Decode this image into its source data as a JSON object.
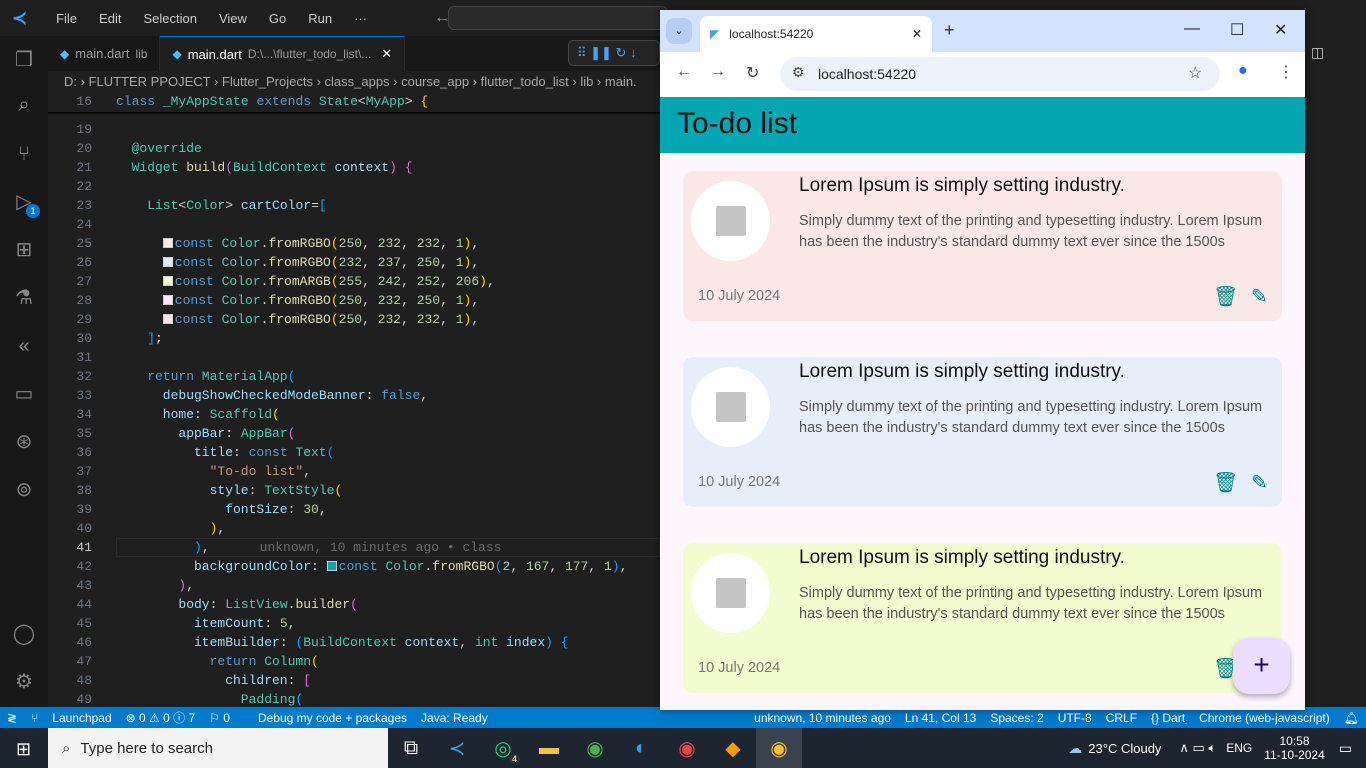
{
  "vscode": {
    "menu": [
      "File",
      "Edit",
      "Selection",
      "View",
      "Go",
      "Run",
      "···"
    ],
    "tabs": [
      {
        "name": "main.dart",
        "sub": "lib"
      },
      {
        "name": "main.dart",
        "sub": "D:\\...\\flutter_todo_list\\...",
        "close": "✕"
      }
    ],
    "breadcrumb": "D: › FLUTTER PPOJECT › Flutter_Projects › class_apps › course_app › flutter_todo_list › lib › main.",
    "debug_badge": "1",
    "current_line": 41,
    "blame": "unknown, 10 minutes ago • class",
    "swatch_colors": [
      "#fae8e8",
      "#e8edfa",
      "#f2fcce",
      "#fae8fa",
      "#fae8e8",
      "#02a7b1"
    ],
    "code": [
      {
        "n": 16,
        "i": 0,
        "t": [
          [
            "k",
            "class "
          ],
          [
            "t",
            "_MyAppState "
          ],
          [
            "k",
            "extends "
          ],
          [
            "t",
            "State"
          ],
          [
            "p",
            "<"
          ],
          [
            "t",
            "MyApp"
          ],
          [
            "p",
            "> "
          ],
          [
            "b1",
            "{"
          ]
        ]
      },
      {
        "n": 19,
        "i": 0,
        "t": []
      },
      {
        "n": 20,
        "i": 2,
        "t": [
          [
            "a",
            "@override"
          ]
        ]
      },
      {
        "n": 21,
        "i": 2,
        "t": [
          [
            "t",
            "Widget "
          ],
          [
            "f",
            "build"
          ],
          [
            "b2",
            "("
          ],
          [
            "t",
            "BuildContext "
          ],
          [
            "v",
            "context"
          ],
          [
            "b2",
            ")"
          ],
          [
            "p",
            " "
          ],
          [
            "b2",
            "{"
          ]
        ]
      },
      {
        "n": 22,
        "i": 0,
        "t": []
      },
      {
        "n": 23,
        "i": 4,
        "t": [
          [
            "t",
            "List"
          ],
          [
            "p",
            "<"
          ],
          [
            "t",
            "Color"
          ],
          [
            "p",
            "> "
          ],
          [
            "v",
            "cartColor"
          ],
          [
            "p",
            "="
          ],
          [
            "b3",
            "["
          ]
        ]
      },
      {
        "n": 24,
        "i": 0,
        "t": []
      },
      {
        "n": 25,
        "i": 6,
        "sw": 0,
        "t": [
          [
            "k",
            "const "
          ],
          [
            "t",
            "Color"
          ],
          [
            "p",
            "."
          ],
          [
            "f",
            "fromRGBO"
          ],
          [
            "b1",
            "("
          ],
          [
            "n",
            "250"
          ],
          [
            "p",
            ", "
          ],
          [
            "n",
            "232"
          ],
          [
            "p",
            ", "
          ],
          [
            "n",
            "232"
          ],
          [
            "p",
            ", "
          ],
          [
            "n",
            "1"
          ],
          [
            "b1",
            ")"
          ],
          [
            "p",
            ","
          ]
        ]
      },
      {
        "n": 26,
        "i": 6,
        "sw": 1,
        "t": [
          [
            "k",
            "const "
          ],
          [
            "t",
            "Color"
          ],
          [
            "p",
            "."
          ],
          [
            "f",
            "fromRGBO"
          ],
          [
            "b1",
            "("
          ],
          [
            "n",
            "232"
          ],
          [
            "p",
            ", "
          ],
          [
            "n",
            "237"
          ],
          [
            "p",
            ", "
          ],
          [
            "n",
            "250"
          ],
          [
            "p",
            ", "
          ],
          [
            "n",
            "1"
          ],
          [
            "b1",
            ")"
          ],
          [
            "p",
            ","
          ]
        ]
      },
      {
        "n": 27,
        "i": 6,
        "sw": 2,
        "t": [
          [
            "k",
            "const "
          ],
          [
            "t",
            "Color"
          ],
          [
            "p",
            "."
          ],
          [
            "f",
            "fromARGB"
          ],
          [
            "b1",
            "("
          ],
          [
            "n",
            "255"
          ],
          [
            "p",
            ", "
          ],
          [
            "n",
            "242"
          ],
          [
            "p",
            ", "
          ],
          [
            "n",
            "252"
          ],
          [
            "p",
            ", "
          ],
          [
            "n",
            "206"
          ],
          [
            "b1",
            ")"
          ],
          [
            "p",
            ","
          ]
        ]
      },
      {
        "n": 28,
        "i": 6,
        "sw": 3,
        "t": [
          [
            "k",
            "const "
          ],
          [
            "t",
            "Color"
          ],
          [
            "p",
            "."
          ],
          [
            "f",
            "fromRGBO"
          ],
          [
            "b1",
            "("
          ],
          [
            "n",
            "250"
          ],
          [
            "p",
            ", "
          ],
          [
            "n",
            "232"
          ],
          [
            "p",
            ", "
          ],
          [
            "n",
            "250"
          ],
          [
            "p",
            ", "
          ],
          [
            "n",
            "1"
          ],
          [
            "b1",
            ")"
          ],
          [
            "p",
            ","
          ]
        ]
      },
      {
        "n": 29,
        "i": 6,
        "sw": 4,
        "t": [
          [
            "k",
            "const "
          ],
          [
            "t",
            "Color"
          ],
          [
            "p",
            "."
          ],
          [
            "f",
            "fromRGBO"
          ],
          [
            "b1",
            "("
          ],
          [
            "n",
            "250"
          ],
          [
            "p",
            ", "
          ],
          [
            "n",
            "232"
          ],
          [
            "p",
            ", "
          ],
          [
            "n",
            "232"
          ],
          [
            "p",
            ", "
          ],
          [
            "n",
            "1"
          ],
          [
            "b1",
            ")"
          ],
          [
            "p",
            ","
          ]
        ]
      },
      {
        "n": 30,
        "i": 4,
        "t": [
          [
            "b3",
            "]"
          ],
          [
            "p",
            ";"
          ]
        ]
      },
      {
        "n": 31,
        "i": 0,
        "t": []
      },
      {
        "n": 32,
        "i": 4,
        "t": [
          [
            "k",
            "return "
          ],
          [
            "t",
            "MaterialApp"
          ],
          [
            "b3",
            "("
          ]
        ]
      },
      {
        "n": 33,
        "i": 6,
        "t": [
          [
            "v",
            "debugShowCheckedModeBanner"
          ],
          [
            "p",
            ": "
          ],
          [
            "k",
            "false"
          ],
          [
            "p",
            ","
          ]
        ]
      },
      {
        "n": 34,
        "i": 6,
        "t": [
          [
            "v",
            "home"
          ],
          [
            "p",
            ": "
          ],
          [
            "t",
            "Scaffold"
          ],
          [
            "b1",
            "("
          ]
        ]
      },
      {
        "n": 35,
        "i": 8,
        "t": [
          [
            "v",
            "appBar"
          ],
          [
            "p",
            ": "
          ],
          [
            "t",
            "AppBar"
          ],
          [
            "b2",
            "("
          ]
        ]
      },
      {
        "n": 36,
        "i": 10,
        "t": [
          [
            "v",
            "title"
          ],
          [
            "p",
            ": "
          ],
          [
            "k",
            "const "
          ],
          [
            "t",
            "Text"
          ],
          [
            "b3",
            "("
          ]
        ]
      },
      {
        "n": 37,
        "i": 12,
        "t": [
          [
            "s",
            "\"To-do list\""
          ],
          [
            "p",
            ","
          ]
        ]
      },
      {
        "n": 38,
        "i": 12,
        "t": [
          [
            "v",
            "style"
          ],
          [
            "p",
            ": "
          ],
          [
            "t",
            "TextStyle"
          ],
          [
            "b1",
            "("
          ]
        ]
      },
      {
        "n": 39,
        "i": 14,
        "t": [
          [
            "v",
            "fontSize"
          ],
          [
            "p",
            ": "
          ],
          [
            "n",
            "30"
          ],
          [
            "p",
            ","
          ]
        ]
      },
      {
        "n": 40,
        "i": 12,
        "t": [
          [
            "b1",
            ")"
          ],
          [
            "p",
            ","
          ]
        ]
      },
      {
        "n": 41,
        "i": 10,
        "blame": true,
        "t": [
          [
            "b3",
            ")"
          ],
          [
            "p",
            ","
          ]
        ]
      },
      {
        "n": 42,
        "i": 10,
        "t": [
          [
            "v",
            "backgroundColor"
          ],
          [
            "p",
            ": "
          ],
          [
            "sw5",
            ""
          ],
          [
            "k",
            "const "
          ],
          [
            "t",
            "Color"
          ],
          [
            "p",
            "."
          ],
          [
            "f",
            "fromRGBO"
          ],
          [
            "b3",
            "("
          ],
          [
            "n",
            "2"
          ],
          [
            "p",
            ", "
          ],
          [
            "n",
            "167"
          ],
          [
            "p",
            ", "
          ],
          [
            "n",
            "177"
          ],
          [
            "p",
            ", "
          ],
          [
            "n",
            "1"
          ],
          [
            "b3",
            ")"
          ],
          [
            "p",
            ","
          ]
        ]
      },
      {
        "n": 43,
        "i": 8,
        "t": [
          [
            "b2",
            ")"
          ],
          [
            "p",
            ","
          ]
        ]
      },
      {
        "n": 44,
        "i": 8,
        "t": [
          [
            "v",
            "body"
          ],
          [
            "p",
            ": "
          ],
          [
            "t",
            "ListView"
          ],
          [
            "p",
            "."
          ],
          [
            "f",
            "builder"
          ],
          [
            "b2",
            "("
          ]
        ]
      },
      {
        "n": 45,
        "i": 10,
        "t": [
          [
            "v",
            "itemCount"
          ],
          [
            "p",
            ": "
          ],
          [
            "n",
            "5"
          ],
          [
            "p",
            ","
          ]
        ]
      },
      {
        "n": 46,
        "i": 10,
        "t": [
          [
            "v",
            "itemBuilder"
          ],
          [
            "p",
            ": "
          ],
          [
            "b3",
            "("
          ],
          [
            "t",
            "BuildContext "
          ],
          [
            "v",
            "context"
          ],
          [
            "p",
            ", "
          ],
          [
            "t",
            "int "
          ],
          [
            "v",
            "index"
          ],
          [
            "b3",
            ")"
          ],
          [
            "p",
            " "
          ],
          [
            "b3",
            "{"
          ]
        ]
      },
      {
        "n": 47,
        "i": 12,
        "t": [
          [
            "k",
            "return "
          ],
          [
            "t",
            "Column"
          ],
          [
            "b1",
            "("
          ]
        ]
      },
      {
        "n": 48,
        "i": 14,
        "t": [
          [
            "v",
            "children"
          ],
          [
            "p",
            ": "
          ],
          [
            "b2",
            "["
          ]
        ]
      },
      {
        "n": 49,
        "i": 16,
        "t": [
          [
            "t",
            "Padding"
          ],
          [
            "b3",
            "("
          ]
        ]
      }
    ],
    "status": {
      "launchpad": "Launchpad",
      "problems": "⊗ 0 ⚠ 0 ⓘ 7",
      "ports": "⚐ 0",
      "debug": "Debug my code + packages",
      "java": "Java: Ready",
      "blame": "unknown, 10 minutes ago",
      "position": "Ln 41, Col 13",
      "spaces": "Spaces: 2",
      "encoding": "UTF-8",
      "eol": "CRLF",
      "language": "{} Dart",
      "device": "Chrome (web-javascript)"
    }
  },
  "browser": {
    "tab_title": "localhost:54220",
    "tab_close": "✕",
    "new_tab": "+",
    "url": "localhost:54220",
    "app": {
      "title": "To-do list",
      "accent": "#02a7b1",
      "cards": [
        {
          "title": "Lorem Ipsum is simply setting industry.",
          "desc": "Simply dummy text of the printing and typesetting industry. Lorem Ipsum has been the industry's standard dummy text ever since the 1500s",
          "date": "10 July 2024",
          "color": "#fae8e8"
        },
        {
          "title": "Lorem Ipsum is simply setting industry.",
          "desc": "Simply dummy text of the printing and typesetting industry. Lorem Ipsum has been the industry's standard dummy text ever since the 1500s",
          "date": "10 July 2024",
          "color": "#e8edfa"
        },
        {
          "title": "Lorem Ipsum is simply setting industry.",
          "desc": "Simply dummy text of the printing and typesetting industry. Lorem Ipsum has been the industry's standard dummy text ever since the 1500s",
          "date": "10 July 2024",
          "color": "#f2fcce"
        }
      ],
      "fab": "+"
    }
  },
  "taskbar": {
    "search_placeholder": "Type here to search",
    "whatsapp_badge": "4",
    "weather": "23°C  Cloudy",
    "lang": "ENG",
    "time": "10:58",
    "date": "11-10-2024"
  }
}
